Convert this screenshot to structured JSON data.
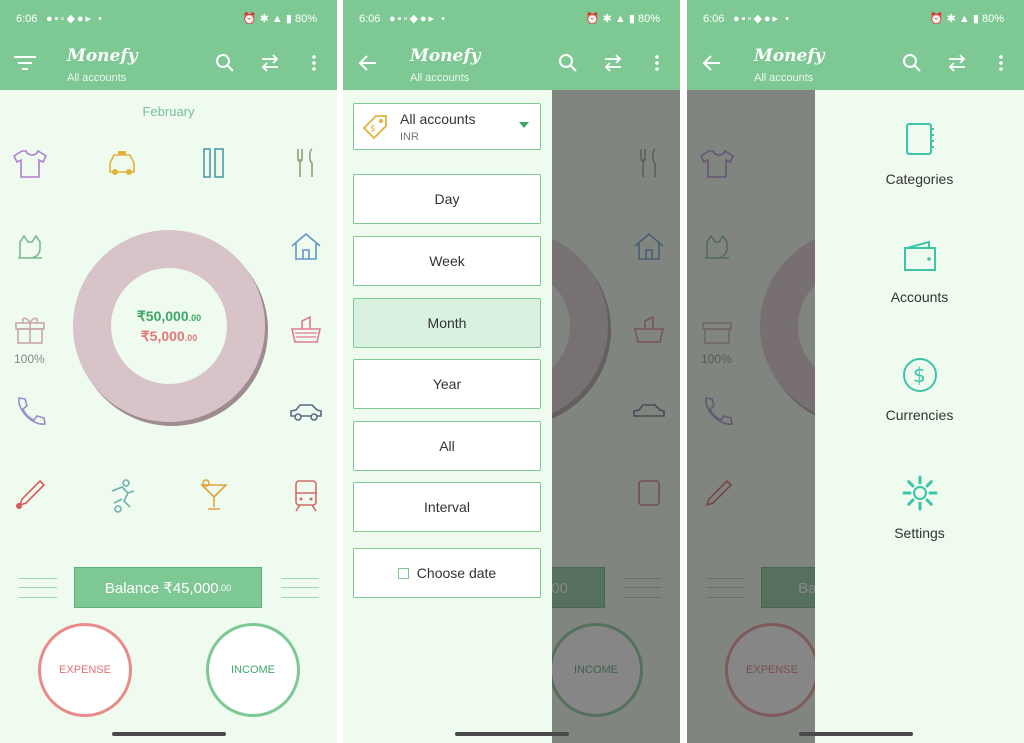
{
  "status": {
    "time": "6:06",
    "battery": "80%"
  },
  "appbar": {
    "brand": "Monefy",
    "subtitle": "All accounts"
  },
  "main": {
    "month": "February",
    "income_amount": "₹50,000",
    "income_decimals": ".00",
    "expense_amount": "₹5,000",
    "expense_decimals": ".00",
    "percent": "100%",
    "balance_label": "Balance ₹45,000",
    "balance_decimals": ".00",
    "expense_label": "EXPENSE",
    "income_label": "INCOME"
  },
  "colors": {
    "accent": "#7ec893",
    "expense": "#e46f6f",
    "income": "#3fa66a",
    "donut": "#d8c3c9"
  },
  "categories": [
    "shirt-icon",
    "taxi-icon",
    "toiletries-icon",
    "cutlery-icon",
    "pet-icon",
    "house-icon",
    "gift-icon",
    "groceries-icon",
    "phone-icon",
    "car-icon",
    "thermometer-icon",
    "sports-icon",
    "cocktail-icon",
    "train-icon"
  ],
  "period_panel": {
    "account_name": "All accounts",
    "account_currency": "INR",
    "periods": [
      "Day",
      "Week",
      "Month",
      "Year",
      "All",
      "Interval"
    ],
    "active_period": "Month",
    "choose_date": "Choose date"
  },
  "right_menu": {
    "items": [
      {
        "label": "Categories",
        "icon": "notebook-icon"
      },
      {
        "label": "Accounts",
        "icon": "wallet-icon"
      },
      {
        "label": "Currencies",
        "icon": "dollar-icon"
      },
      {
        "label": "Settings",
        "icon": "gear-icon"
      }
    ]
  }
}
